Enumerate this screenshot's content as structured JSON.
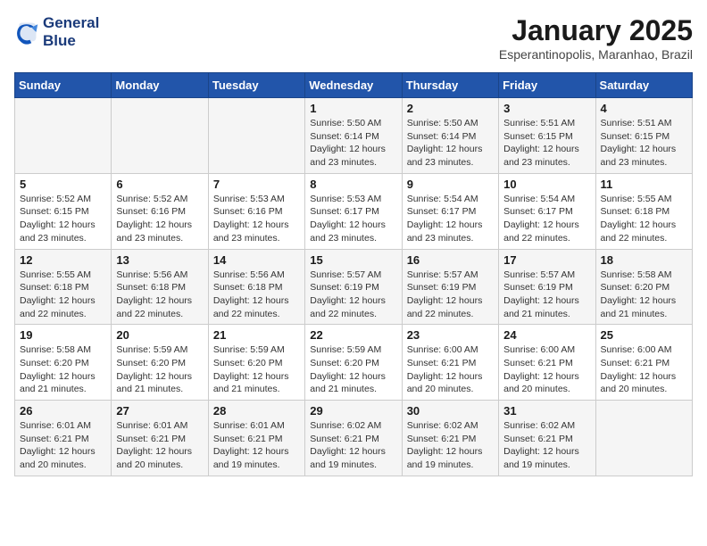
{
  "logo": {
    "line1": "General",
    "line2": "Blue"
  },
  "title": "January 2025",
  "subtitle": "Esperantinopolis, Maranhao, Brazil",
  "weekdays": [
    "Sunday",
    "Monday",
    "Tuesday",
    "Wednesday",
    "Thursday",
    "Friday",
    "Saturday"
  ],
  "weeks": [
    [
      {
        "day": "",
        "sunrise": "",
        "sunset": "",
        "daylight": ""
      },
      {
        "day": "",
        "sunrise": "",
        "sunset": "",
        "daylight": ""
      },
      {
        "day": "",
        "sunrise": "",
        "sunset": "",
        "daylight": ""
      },
      {
        "day": "1",
        "sunrise": "Sunrise: 5:50 AM",
        "sunset": "Sunset: 6:14 PM",
        "daylight": "Daylight: 12 hours and 23 minutes."
      },
      {
        "day": "2",
        "sunrise": "Sunrise: 5:50 AM",
        "sunset": "Sunset: 6:14 PM",
        "daylight": "Daylight: 12 hours and 23 minutes."
      },
      {
        "day": "3",
        "sunrise": "Sunrise: 5:51 AM",
        "sunset": "Sunset: 6:15 PM",
        "daylight": "Daylight: 12 hours and 23 minutes."
      },
      {
        "day": "4",
        "sunrise": "Sunrise: 5:51 AM",
        "sunset": "Sunset: 6:15 PM",
        "daylight": "Daylight: 12 hours and 23 minutes."
      }
    ],
    [
      {
        "day": "5",
        "sunrise": "Sunrise: 5:52 AM",
        "sunset": "Sunset: 6:15 PM",
        "daylight": "Daylight: 12 hours and 23 minutes."
      },
      {
        "day": "6",
        "sunrise": "Sunrise: 5:52 AM",
        "sunset": "Sunset: 6:16 PM",
        "daylight": "Daylight: 12 hours and 23 minutes."
      },
      {
        "day": "7",
        "sunrise": "Sunrise: 5:53 AM",
        "sunset": "Sunset: 6:16 PM",
        "daylight": "Daylight: 12 hours and 23 minutes."
      },
      {
        "day": "8",
        "sunrise": "Sunrise: 5:53 AM",
        "sunset": "Sunset: 6:17 PM",
        "daylight": "Daylight: 12 hours and 23 minutes."
      },
      {
        "day": "9",
        "sunrise": "Sunrise: 5:54 AM",
        "sunset": "Sunset: 6:17 PM",
        "daylight": "Daylight: 12 hours and 23 minutes."
      },
      {
        "day": "10",
        "sunrise": "Sunrise: 5:54 AM",
        "sunset": "Sunset: 6:17 PM",
        "daylight": "Daylight: 12 hours and 22 minutes."
      },
      {
        "day": "11",
        "sunrise": "Sunrise: 5:55 AM",
        "sunset": "Sunset: 6:18 PM",
        "daylight": "Daylight: 12 hours and 22 minutes."
      }
    ],
    [
      {
        "day": "12",
        "sunrise": "Sunrise: 5:55 AM",
        "sunset": "Sunset: 6:18 PM",
        "daylight": "Daylight: 12 hours and 22 minutes."
      },
      {
        "day": "13",
        "sunrise": "Sunrise: 5:56 AM",
        "sunset": "Sunset: 6:18 PM",
        "daylight": "Daylight: 12 hours and 22 minutes."
      },
      {
        "day": "14",
        "sunrise": "Sunrise: 5:56 AM",
        "sunset": "Sunset: 6:18 PM",
        "daylight": "Daylight: 12 hours and 22 minutes."
      },
      {
        "day": "15",
        "sunrise": "Sunrise: 5:57 AM",
        "sunset": "Sunset: 6:19 PM",
        "daylight": "Daylight: 12 hours and 22 minutes."
      },
      {
        "day": "16",
        "sunrise": "Sunrise: 5:57 AM",
        "sunset": "Sunset: 6:19 PM",
        "daylight": "Daylight: 12 hours and 22 minutes."
      },
      {
        "day": "17",
        "sunrise": "Sunrise: 5:57 AM",
        "sunset": "Sunset: 6:19 PM",
        "daylight": "Daylight: 12 hours and 21 minutes."
      },
      {
        "day": "18",
        "sunrise": "Sunrise: 5:58 AM",
        "sunset": "Sunset: 6:20 PM",
        "daylight": "Daylight: 12 hours and 21 minutes."
      }
    ],
    [
      {
        "day": "19",
        "sunrise": "Sunrise: 5:58 AM",
        "sunset": "Sunset: 6:20 PM",
        "daylight": "Daylight: 12 hours and 21 minutes."
      },
      {
        "day": "20",
        "sunrise": "Sunrise: 5:59 AM",
        "sunset": "Sunset: 6:20 PM",
        "daylight": "Daylight: 12 hours and 21 minutes."
      },
      {
        "day": "21",
        "sunrise": "Sunrise: 5:59 AM",
        "sunset": "Sunset: 6:20 PM",
        "daylight": "Daylight: 12 hours and 21 minutes."
      },
      {
        "day": "22",
        "sunrise": "Sunrise: 5:59 AM",
        "sunset": "Sunset: 6:20 PM",
        "daylight": "Daylight: 12 hours and 21 minutes."
      },
      {
        "day": "23",
        "sunrise": "Sunrise: 6:00 AM",
        "sunset": "Sunset: 6:21 PM",
        "daylight": "Daylight: 12 hours and 20 minutes."
      },
      {
        "day": "24",
        "sunrise": "Sunrise: 6:00 AM",
        "sunset": "Sunset: 6:21 PM",
        "daylight": "Daylight: 12 hours and 20 minutes."
      },
      {
        "day": "25",
        "sunrise": "Sunrise: 6:00 AM",
        "sunset": "Sunset: 6:21 PM",
        "daylight": "Daylight: 12 hours and 20 minutes."
      }
    ],
    [
      {
        "day": "26",
        "sunrise": "Sunrise: 6:01 AM",
        "sunset": "Sunset: 6:21 PM",
        "daylight": "Daylight: 12 hours and 20 minutes."
      },
      {
        "day": "27",
        "sunrise": "Sunrise: 6:01 AM",
        "sunset": "Sunset: 6:21 PM",
        "daylight": "Daylight: 12 hours and 20 minutes."
      },
      {
        "day": "28",
        "sunrise": "Sunrise: 6:01 AM",
        "sunset": "Sunset: 6:21 PM",
        "daylight": "Daylight: 12 hours and 19 minutes."
      },
      {
        "day": "29",
        "sunrise": "Sunrise: 6:02 AM",
        "sunset": "Sunset: 6:21 PM",
        "daylight": "Daylight: 12 hours and 19 minutes."
      },
      {
        "day": "30",
        "sunrise": "Sunrise: 6:02 AM",
        "sunset": "Sunset: 6:21 PM",
        "daylight": "Daylight: 12 hours and 19 minutes."
      },
      {
        "day": "31",
        "sunrise": "Sunrise: 6:02 AM",
        "sunset": "Sunset: 6:21 PM",
        "daylight": "Daylight: 12 hours and 19 minutes."
      },
      {
        "day": "",
        "sunrise": "",
        "sunset": "",
        "daylight": ""
      }
    ]
  ]
}
